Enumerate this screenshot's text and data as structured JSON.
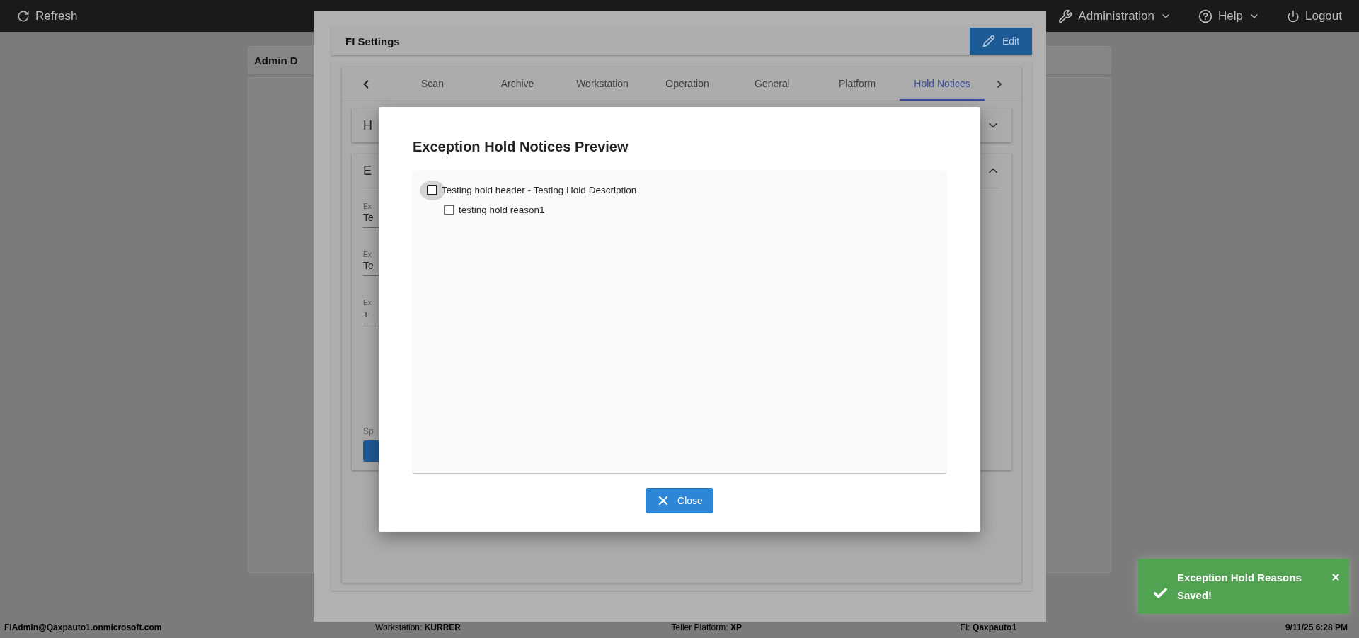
{
  "top_bar": {
    "refresh": "Refresh",
    "menus": [
      {
        "kind": "admin",
        "label": "Administration"
      },
      {
        "kind": "help",
        "label": "Help"
      }
    ],
    "logout": "Logout"
  },
  "admin_card": {
    "title": "Admin D"
  },
  "fi_settings": {
    "title": "FI Settings",
    "edit_button": "Edit",
    "tabs": [
      {
        "label": "Scan",
        "selected": false
      },
      {
        "label": "Archive",
        "selected": false
      },
      {
        "label": "Workstation",
        "selected": false
      },
      {
        "label": "Operation",
        "selected": false
      },
      {
        "label": "General",
        "selected": false
      },
      {
        "label": "Platform",
        "selected": false
      },
      {
        "label": "Hold Notices",
        "selected": true
      }
    ],
    "accordions": [
      {
        "title": "H",
        "expanded": false
      },
      {
        "title": "E",
        "expanded": true,
        "fields": [
          {
            "label": "Ex",
            "value": "Te"
          },
          {
            "label": "Ex",
            "value": "Te"
          },
          {
            "label": "Ex",
            "value": "+"
          }
        ],
        "footer_label": "Sp"
      }
    ]
  },
  "dialog": {
    "title": "Exception Hold Notices Preview",
    "tree": [
      {
        "label": "Testing hold header - Testing Hold Description",
        "checked": false,
        "focused": true,
        "children": [
          {
            "label": "testing hold reason1",
            "checked": false,
            "focused": false
          }
        ]
      }
    ],
    "close_button": "Close"
  },
  "toast": {
    "message": "Exception Hold Reasons Saved!"
  },
  "status_bar": {
    "user": "FiAdmin@Qaxpauto1.onmicrosoft.com",
    "items": [
      {
        "label": "Workstation:",
        "value": "KURRER"
      },
      {
        "label": "Teller Platform:",
        "value": "XP"
      },
      {
        "label": "FI:",
        "value": "Qaxpauto1"
      }
    ],
    "datetime": "9/11/25 6:28 PM"
  }
}
